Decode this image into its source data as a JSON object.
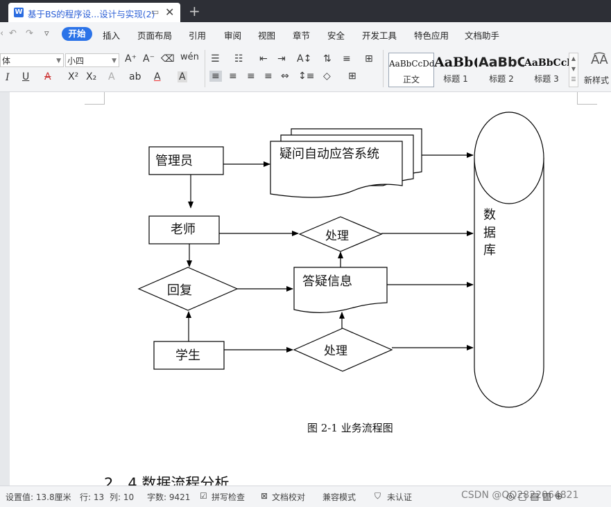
{
  "window": {
    "tab_title": "基于BS的程序设...设计与实现(2)",
    "new_tab": "+"
  },
  "menu": {
    "items": [
      "开始",
      "插入",
      "页面布局",
      "引用",
      "审阅",
      "视图",
      "章节",
      "安全",
      "开发工具",
      "特色应用",
      "文档助手"
    ]
  },
  "ribbon": {
    "font_name": "体",
    "font_size": "小四",
    "styles": [
      {
        "sample": "AaBbCcDd",
        "label": "正文"
      },
      {
        "sample": "AaBb(",
        "label": "标题 1"
      },
      {
        "sample": "AaBbC",
        "label": "标题 2"
      },
      {
        "sample": "AaBbCcl",
        "label": "标题 3"
      }
    ],
    "new_style": "新样式"
  },
  "flowchart": {
    "admin": "管理员",
    "system": "疑问自动应答系统",
    "teacher": "老师",
    "process_top": "处理",
    "reply": "回复",
    "qa_info": "答疑信息",
    "student": "学生",
    "process_bottom": "处理",
    "database": [
      "数",
      "据",
      "库"
    ]
  },
  "document": {
    "caption": "图 2-1 业务流程图",
    "heading": "2．4 数据流程分析"
  },
  "status": {
    "setting": "设置值: 13.8厘米",
    "row": "行: 13",
    "col": "列: 10",
    "wordcount": "字数: 9421",
    "spell": "拼写检查",
    "proof": "文档校对",
    "compat": "兼容模式",
    "cert": "未认证"
  },
  "watermark": "CSDN @QQ2822064821",
  "colors": {
    "accent": "#2b73e8",
    "titlebar": "#2d2f36",
    "tab_text": "#2b5fd6"
  }
}
